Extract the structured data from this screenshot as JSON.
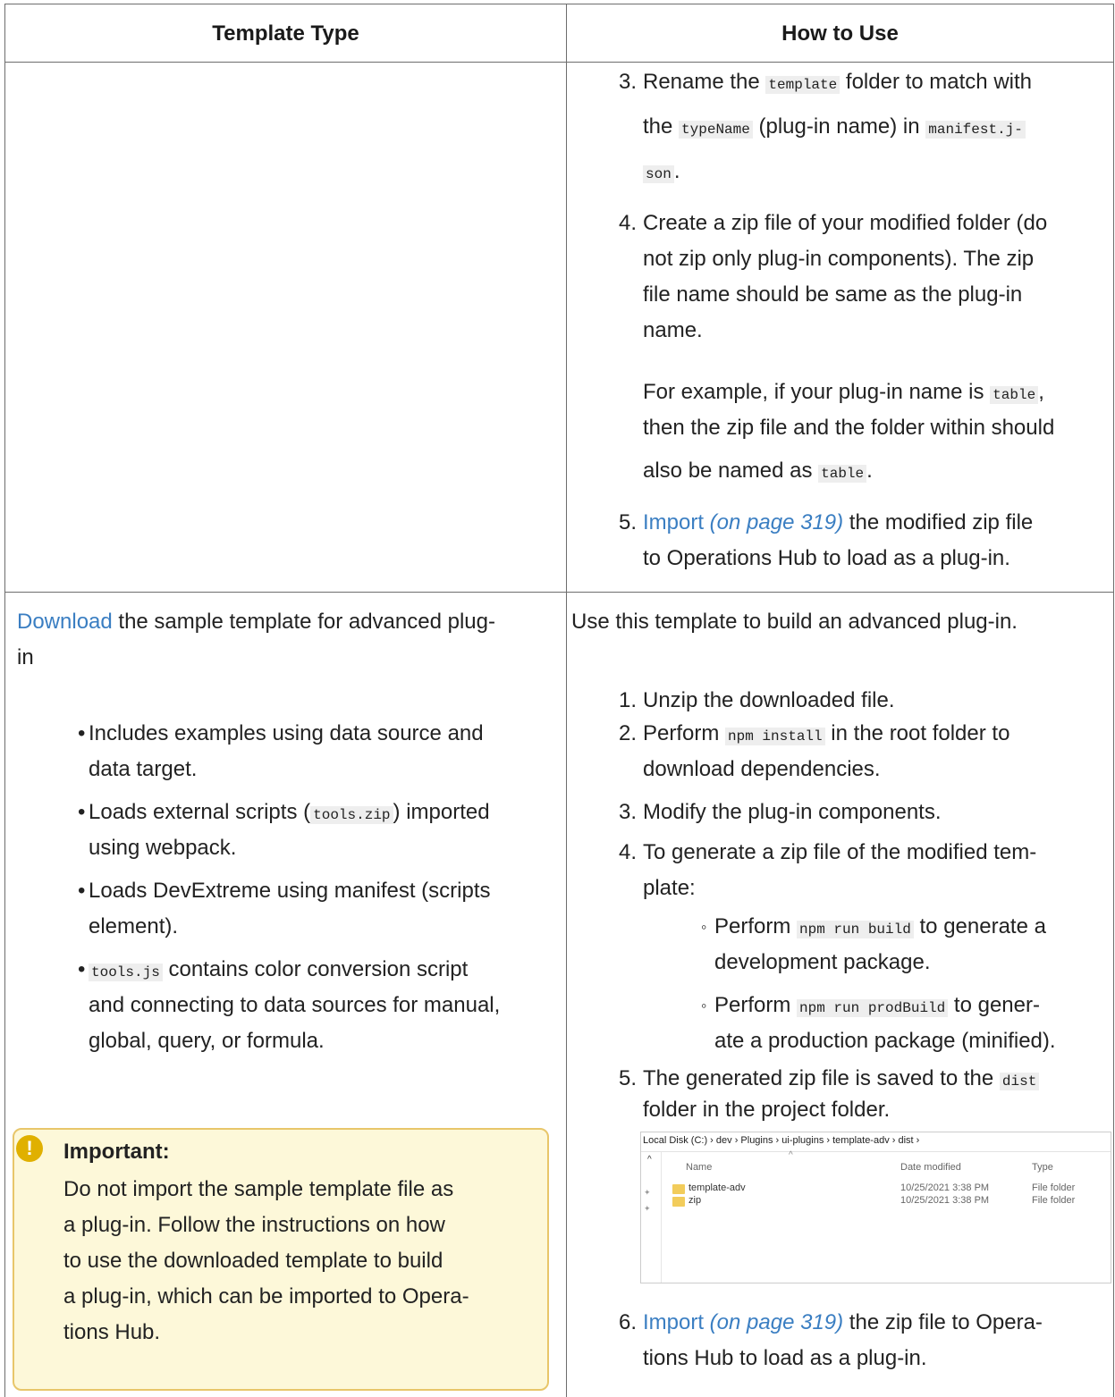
{
  "header": {
    "col1": "Template Type",
    "col2": "How to Use"
  },
  "row1": {
    "step3": {
      "num": "3.",
      "l1a": "Rename the ",
      "l1code": "template",
      "l1b": " folder to match with",
      "l2a": "the ",
      "l2code": "typeName",
      "l2b": " (plug-in name) in ",
      "l2code2": "manifest.j-",
      "l3code": "son",
      "l3b": "."
    },
    "step4": {
      "num": "4.",
      "l1": "Create a zip file of your modified folder (do",
      "l2": "not zip only plug-in components). The zip",
      "l3": "file name should be same as the plug-in",
      "l4": "name."
    },
    "example": {
      "l1a": "For example, if your plug-in name is ",
      "l1code": "table",
      "l1b": ",",
      "l2": "then the zip file and the folder within should",
      "l3a": "also be named as ",
      "l3code": "table",
      "l3b": "."
    },
    "step5": {
      "num": "5.",
      "link": "Import",
      "page": " (on page 319)",
      "l1b": " the modified zip file",
      "l2": "to Operations Hub to load as a plug-in."
    }
  },
  "row2": {
    "left": {
      "download_link": "Download",
      "intro1": " the sample template for advanced plug-",
      "intro2": "in",
      "bullets": {
        "b1a": "Includes examples using data source and",
        "b1b": "data target.",
        "b2a": "Loads external scripts (",
        "b2code": "tools.zip",
        "b2b": ") imported",
        "b2c": "using webpack.",
        "b3a": "Loads DevExtreme using manifest (scripts",
        "b3b": "element).",
        "b4code": "tools.js",
        "b4a": " contains color conversion script",
        "b4b": "and connecting to data sources for manual,",
        "b4c": "global, query, or formula."
      },
      "important": {
        "title": "Important:",
        "l1": "Do not import the sample template file as",
        "l2": "a plug-in. Follow the instructions on how",
        "l3": "to use the downloaded template to build",
        "l4": "a plug-in, which can be imported to Opera-",
        "l5": "tions Hub."
      }
    },
    "right": {
      "intro": "Use this template to build an advanced plug-in.",
      "s1": {
        "num": "1.",
        "text": "Unzip the downloaded file."
      },
      "s2": {
        "num": "2.",
        "a": "Perform ",
        "code": "npm install",
        "b": " in the root folder to",
        "c": "download dependencies."
      },
      "s3": {
        "num": "3.",
        "text": "Modify the plug-in components."
      },
      "s4": {
        "num": "4.",
        "a": "To generate a zip file of the modified tem-",
        "b": "plate:"
      },
      "sub1": {
        "a": "Perform ",
        "code": "npm run build",
        "b": " to generate a",
        "c": "development package."
      },
      "sub2": {
        "a": "Perform ",
        "code": "npm run prodBuild",
        "b": " to gener-",
        "c": "ate a production package (minified)."
      },
      "s5": {
        "num": "5.",
        "a": "The generated zip file is saved to the ",
        "code": "dist",
        "b": "folder in the project folder."
      },
      "s6": {
        "num": "6.",
        "link": "Import",
        "page": " (on page 319)",
        "a": " the zip file to Opera-",
        "b": "tions Hub to load as a plug-in."
      }
    },
    "explorer": {
      "path": "Local Disk (C:)  ›  dev  ›  Plugins  ›  ui-plugins  ›  template-adv  ›  dist  ›",
      "col_name": "Name",
      "col_date": "Date modified",
      "col_type": "Type",
      "rows": [
        {
          "name": "template-adv",
          "date": "10/25/2021 3:38 PM",
          "type": "File folder"
        },
        {
          "name": "zip",
          "date": "10/25/2021 3:38 PM",
          "type": "File folder"
        }
      ]
    }
  }
}
